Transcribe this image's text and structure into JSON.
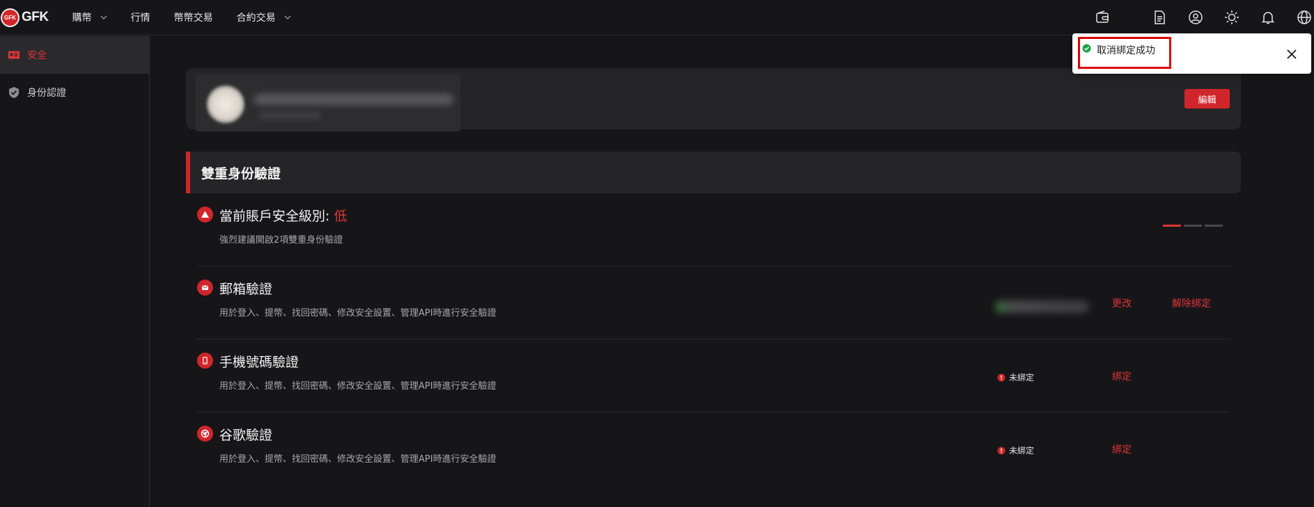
{
  "app": {
    "logo_badge": "GFK",
    "logo_text": "GFK"
  },
  "nav": {
    "items": [
      {
        "label": "購幣",
        "has_dropdown": true
      },
      {
        "label": "行情",
        "has_dropdown": false
      },
      {
        "label": "幣幣交易",
        "has_dropdown": false
      },
      {
        "label": "合約交易",
        "has_dropdown": true
      }
    ],
    "icons": [
      "wallet-icon",
      "orders-icon",
      "user-icon",
      "theme-sun-icon",
      "bell-icon",
      "globe-icon"
    ]
  },
  "sidebar": {
    "items": [
      {
        "label": "安全",
        "icon": "id-card-icon",
        "active": true
      },
      {
        "label": "身份認證",
        "icon": "shield-check-icon",
        "active": false
      }
    ]
  },
  "profile": {
    "edit_label": "編輯"
  },
  "security": {
    "section_title": "雙重身份驗證",
    "level": {
      "title": "當前賬戶安全級別:",
      "value": "低",
      "desc": "強烈建議開啟2項雙重身份驗證",
      "bars_filled": 1,
      "bars_total": 3
    },
    "methods": [
      {
        "title": "郵箱驗證",
        "desc": "用於登入、提幣、找回密碼、修改安全設置、管理API時進行安全驗證",
        "icon": "mail-icon",
        "bound": true,
        "change_label": "更改",
        "unbind_label": "解除綁定"
      },
      {
        "title": "手機號碼驗證",
        "desc": "用於登入、提幣、找回密碼、修改安全設置、管理API時進行安全驗證",
        "icon": "phone-icon",
        "bound": false,
        "status": "未綁定",
        "bind_label": "綁定"
      },
      {
        "title": "谷歌驗證",
        "desc": "用於登入、提幣、找回密碼、修改安全設置、管理API時進行安全驗證",
        "icon": "chrome-icon",
        "bound": false,
        "status": "未綁定",
        "bind_label": "綁定"
      }
    ]
  },
  "toast": {
    "message": "取消綁定成功"
  },
  "colors": {
    "accent": "#d0262b",
    "background": "#161618",
    "card": "#252527",
    "success": "#19a14a"
  }
}
